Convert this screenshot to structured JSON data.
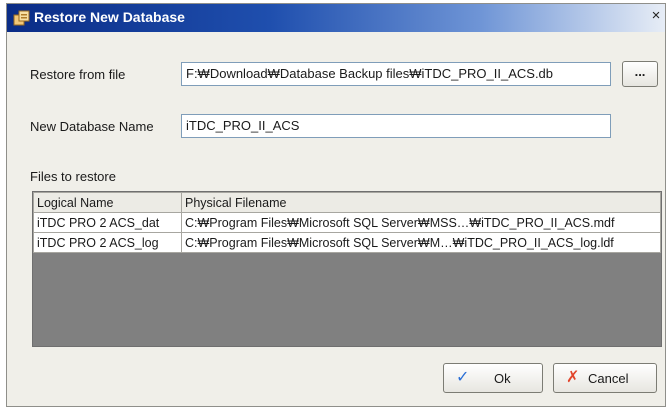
{
  "window": {
    "title": "Restore New Database",
    "close_glyph": "×"
  },
  "form": {
    "restore_from_file_label": "Restore from file",
    "restore_from_file_value": "F:₩Download₩Database Backup files₩iTDC_PRO_II_ACS.db",
    "browse_button_label": "...",
    "new_db_name_label": "New Database Name",
    "new_db_name_value": "iTDC_PRO_II_ACS",
    "files_to_restore_label": "Files to restore"
  },
  "files_table": {
    "columns": [
      "Logical Name",
      "Physical Filename"
    ],
    "rows": [
      [
        "iTDC PRO 2 ACS_dat",
        "C:₩Program Files₩Microsoft SQL Server₩MSS…₩iTDC_PRO_II_ACS.mdf"
      ],
      [
        "iTDC PRO 2 ACS_log",
        "C:₩Program Files₩Microsoft SQL Server₩M…₩iTDC_PRO_II_ACS_log.ldf"
      ]
    ]
  },
  "buttons": {
    "ok_label": "Ok",
    "cancel_label": "Cancel",
    "ok_icon": "checkmark-icon",
    "cancel_icon": "cross-icon"
  },
  "colors": {
    "title_bar_start": "#0a2c86",
    "title_bar_end": "#e7edf6",
    "dialog_background": "#f0efe9",
    "grid_empty_area": "#808080",
    "ok_icon_color": "#2b6fd6",
    "cancel_icon_color": "#e2452b"
  }
}
